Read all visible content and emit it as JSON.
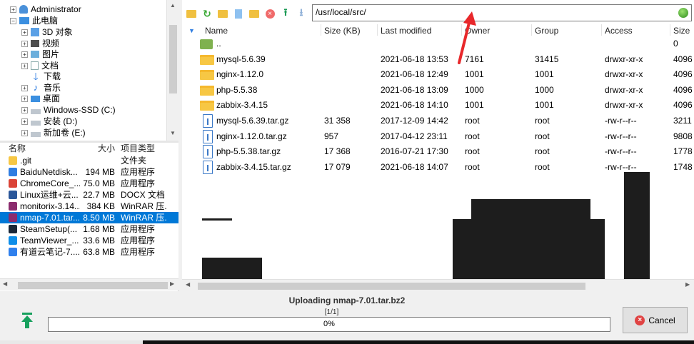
{
  "tree": {
    "items": [
      {
        "label": "Administrator",
        "icon": "user-folder-icon"
      },
      {
        "label": "此电脑",
        "icon": "computer-icon"
      },
      {
        "label": "3D 对象",
        "icon": "3d-objects-icon"
      },
      {
        "label": "视频",
        "icon": "video-icon"
      },
      {
        "label": "图片",
        "icon": "pictures-icon"
      },
      {
        "label": "文档",
        "icon": "documents-icon"
      },
      {
        "label": "下载",
        "icon": "download-icon"
      },
      {
        "label": "音乐",
        "icon": "music-icon"
      },
      {
        "label": "桌面",
        "icon": "desktop-icon"
      },
      {
        "label": "Windows-SSD (C:)",
        "icon": "drive-icon"
      },
      {
        "label": "安装 (D:)",
        "icon": "drive-icon"
      },
      {
        "label": "新加卷 (E:)",
        "icon": "drive-icon"
      }
    ]
  },
  "local_list": {
    "headers": {
      "name": "名称",
      "size": "大小",
      "type": "项目类型"
    },
    "rows": [
      {
        "name": ".git",
        "size": "",
        "type": "文件夹",
        "color": "#f7c744"
      },
      {
        "name": "BaiduNetdisk...",
        "size": "194 MB",
        "type": "应用程序",
        "color": "#2f7de1"
      },
      {
        "name": "ChromeCore_...",
        "size": "75.0 MB",
        "type": "应用程序",
        "color": "#db4437"
      },
      {
        "name": "Linux运维+云...",
        "size": "22.7 MB",
        "type": "DOCX 文档",
        "color": "#2b579a"
      },
      {
        "name": "monitorix-3.14...",
        "size": "384 KB",
        "type": "WinRAR 压...",
        "color": "#8b2c6e"
      },
      {
        "name": "nmap-7.01.tar...",
        "size": "8.50 MB",
        "type": "WinRAR 压...",
        "color": "#8b2c6e",
        "selected": true
      },
      {
        "name": "SteamSetup(...",
        "size": "1.68 MB",
        "type": "应用程序",
        "color": "#1b2838"
      },
      {
        "name": "TeamViewer_...",
        "size": "33.6 MB",
        "type": "应用程序",
        "color": "#0e8ee9"
      },
      {
        "name": "有道云笔记-7....",
        "size": "63.8 MB",
        "type": "应用程序",
        "color": "#2f80ed"
      }
    ]
  },
  "remote": {
    "path": "/usr/local/src/",
    "headers": {
      "name": "Name",
      "size": "Size (KB)",
      "modified": "Last modified",
      "owner": "Owner",
      "group": "Group",
      "access": "Access",
      "size2": "Size"
    },
    "rows": [
      {
        "kind": "up",
        "name": "..",
        "size": "",
        "modified": "",
        "owner": "",
        "group": "",
        "access": "",
        "size2": "0"
      },
      {
        "kind": "folder",
        "name": "mysql-5.6.39",
        "size": "",
        "modified": "2021-06-18 13:53",
        "owner": "7161",
        "group": "31415",
        "access": "drwxr-xr-x",
        "size2": "4096"
      },
      {
        "kind": "folder",
        "name": "nginx-1.12.0",
        "size": "",
        "modified": "2021-06-18 12:49",
        "owner": "1001",
        "group": "1001",
        "access": "drwxr-xr-x",
        "size2": "4096"
      },
      {
        "kind": "folder",
        "name": "php-5.5.38",
        "size": "",
        "modified": "2021-06-18 13:09",
        "owner": "1000",
        "group": "1000",
        "access": "drwxr-xr-x",
        "size2": "4096"
      },
      {
        "kind": "folder",
        "name": "zabbix-3.4.15",
        "size": "",
        "modified": "2021-06-18 14:10",
        "owner": "1001",
        "group": "1001",
        "access": "drwxr-xr-x",
        "size2": "4096"
      },
      {
        "kind": "file",
        "name": "mysql-5.6.39.tar.gz",
        "size": "31 358",
        "modified": "2017-12-09 14:42",
        "owner": "root",
        "group": "root",
        "access": "-rw-r--r--",
        "size2": "3211"
      },
      {
        "kind": "file",
        "name": "nginx-1.12.0.tar.gz",
        "size": "957",
        "modified": "2017-04-12 23:11",
        "owner": "root",
        "group": "root",
        "access": "-rw-r--r--",
        "size2": "9808"
      },
      {
        "kind": "file",
        "name": "php-5.5.38.tar.gz",
        "size": "17 368",
        "modified": "2016-07-21 17:30",
        "owner": "root",
        "group": "root",
        "access": "-rw-r--r--",
        "size2": "1778"
      },
      {
        "kind": "file",
        "name": "zabbix-3.4.15.tar.gz",
        "size": "17 079",
        "modified": "2021-06-18 14:07",
        "owner": "root",
        "group": "root",
        "access": "-rw-r--r--",
        "size2": "1748"
      }
    ]
  },
  "upload": {
    "title": "Uploading nmap-7.01.tar.bz2",
    "count": "[1/1]",
    "progress_text": "0%",
    "progress_fraction": 0,
    "cancel_label": "Cancel"
  },
  "colors": {
    "selection": "#0078d7",
    "folder": "#f7c744",
    "file_outline": "#3a78c7",
    "progress": "#06b025"
  }
}
